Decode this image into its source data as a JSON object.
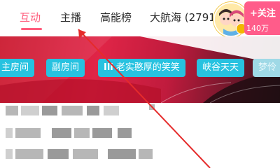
{
  "tabs": [
    {
      "label": "互动",
      "active": true
    },
    {
      "label": "主播",
      "active": false
    },
    {
      "label": "高能榜",
      "active": false
    },
    {
      "label": "大航海 (2791)",
      "active": false
    }
  ],
  "follow": {
    "label": "+关注",
    "fans": "140万"
  },
  "chips": [
    {
      "label": "主房间"
    },
    {
      "label": "副房间"
    },
    {
      "label": "老实憨厚的笑笑",
      "icon": "Ill"
    },
    {
      "label": "峡谷天天"
    },
    {
      "label": "梦伶"
    }
  ],
  "colors": {
    "accent": "#ff5c7c",
    "chip": "#27c2e0",
    "follow": "#ff5c8a",
    "arrow": "#e52b2b"
  },
  "icons": {
    "avatar": "cartoon-couple-avatar",
    "crown": "crown-badge-icon"
  }
}
